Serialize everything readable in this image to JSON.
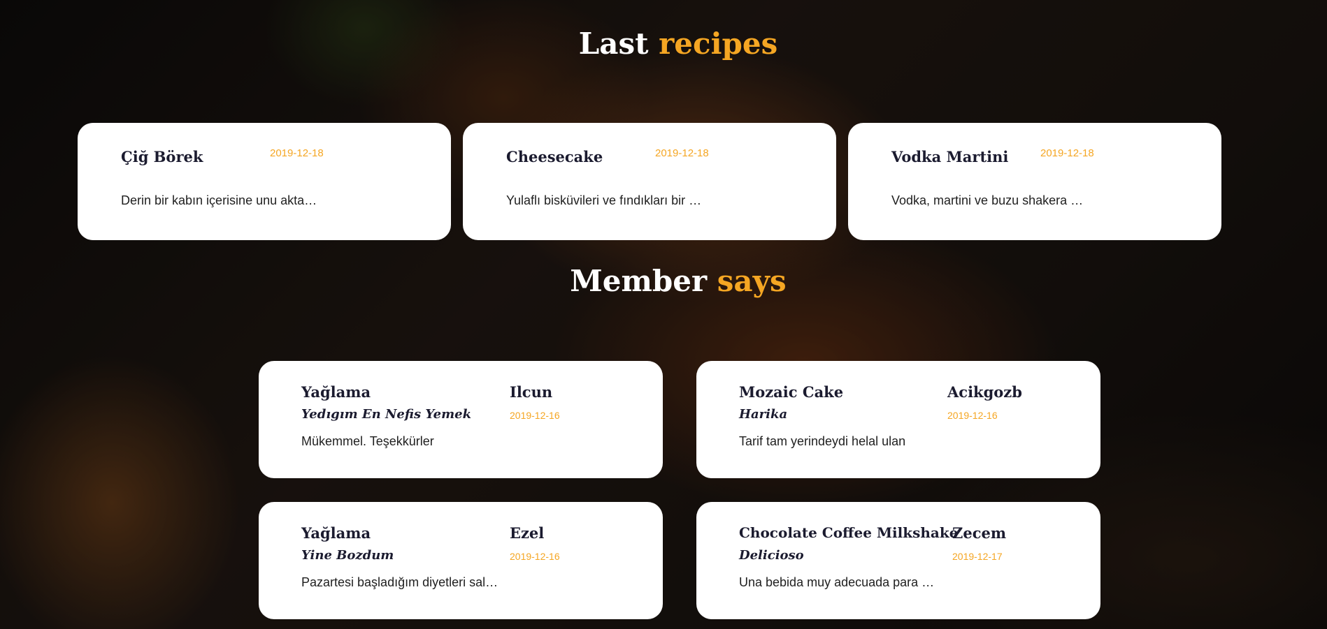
{
  "recipes_section": {
    "title_main": "Last",
    "title_accent": "recipes",
    "items": [
      {
        "name": "Çiğ Börek",
        "date": "2019-12-18",
        "excerpt": "Derin bir kabın içerisine unu akta…"
      },
      {
        "name": "Cheesecake",
        "date": "2019-12-18",
        "excerpt": "Yulaflı bisküvileri ve fındıkları bir …"
      },
      {
        "name": "Vodka Martini",
        "date": "2019-12-18",
        "excerpt": "Vodka, martini ve buzu shakera …"
      }
    ]
  },
  "reviews_section": {
    "title_main": "Member",
    "title_accent": "says",
    "items": [
      {
        "recipe": "Yağlama",
        "title": "Yedıgım En Nefis Yemek",
        "text": "Mükemmel. Teşekkürler",
        "user": "Ilcun",
        "date": "2019-12-16"
      },
      {
        "recipe": "Mozaic Cake",
        "title": "Harika",
        "text": "Tarif tam yerindeydi helal ulan",
        "user": "Acikgozb",
        "date": "2019-12-16"
      },
      {
        "recipe": "Yağlama",
        "title": "Yine Bozdum",
        "text": "Pazartesi başladığım diyetleri sal…",
        "user": "Ezel",
        "date": "2019-12-16"
      },
      {
        "recipe": "Chocolate Coffee Milkshake",
        "title": "Delicioso",
        "text": "Una bebida muy adecuada para …",
        "user": "Zecem",
        "date": "2019-12-17"
      }
    ]
  },
  "colors": {
    "accent": "#f5a623",
    "card_bg": "#ffffff",
    "heading_text": "#1b1b2f"
  }
}
